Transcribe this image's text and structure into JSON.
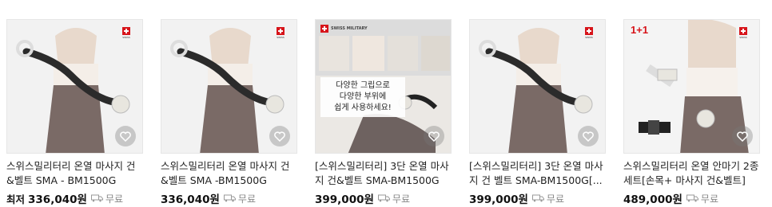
{
  "products": [
    {
      "title": "스위스밀리터리 온열 마사지 건&벨트 SMA - BM1500G",
      "price_prefix": "최저",
      "price": "336,040원",
      "shipping": "무료",
      "image": "woman-massage-belt"
    },
    {
      "title": "스위스밀리터리 온열 마사지 건&벨트 SMA -BM1500G",
      "price_prefix": "",
      "price": "336,040원",
      "shipping": "무료",
      "image": "woman-massage-belt"
    },
    {
      "title": "[스위스밀리터리] 3단 온열 마사지 건&벨트 SMA-BM1500G[...",
      "price_prefix": "",
      "price": "399,000원",
      "shipping": "무료",
      "image": "promo-collage",
      "promo_brand": "SWISS MILITARY",
      "promo_text": [
        "다양한 그립으로",
        "다양한 부위에",
        "쉽게 사용하세요!"
      ]
    },
    {
      "title": "[스위스밀리터리] 3단 온열 마사지 건 벨트 SMA-BM1500G[...",
      "price_prefix": "",
      "price": "399,000원",
      "shipping": "무료",
      "image": "woman-massage-belt"
    },
    {
      "title": "스위스밀리터리 온열 안마기 2종세트[손목+ 마사지 건&벨트]",
      "price_prefix": "",
      "price": "489,000원",
      "shipping": "무료",
      "image": "woman-massage-gun",
      "badge": "1+1"
    }
  ],
  "icons": {
    "wishlist": "heart-icon",
    "shipping": "truck-icon",
    "brand": "swiss-flag-icon"
  },
  "colors": {
    "flag_red": "#d7141a",
    "leggings": "#7a6a66",
    "belt": "#2b2b2b"
  }
}
